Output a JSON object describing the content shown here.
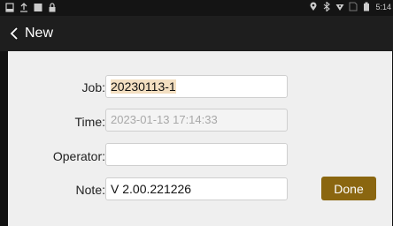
{
  "status_bar": {
    "time": "5:14",
    "left_icons": [
      "screenshot-icon",
      "upload-icon",
      "image-icon",
      "lock-icon"
    ],
    "right_icons": [
      "location-icon",
      "bluetooth-icon",
      "wifi-icon",
      "no-sim-icon",
      "battery-icon"
    ]
  },
  "app_bar": {
    "back_label": "New"
  },
  "form": {
    "job_label": "Job:",
    "job_value": "20230113-1",
    "time_label": "Time:",
    "time_value": "2023-01-13 17:14:33",
    "operator_label": "Operator:",
    "operator_value": "",
    "note_label": "Note:",
    "note_value": "V 2.00.221226",
    "done_label": "Done"
  },
  "colors": {
    "accent": "#8a6610",
    "selection": "#f3dfc1",
    "background": "#efefef",
    "app_bar": "#1e1e1e"
  }
}
